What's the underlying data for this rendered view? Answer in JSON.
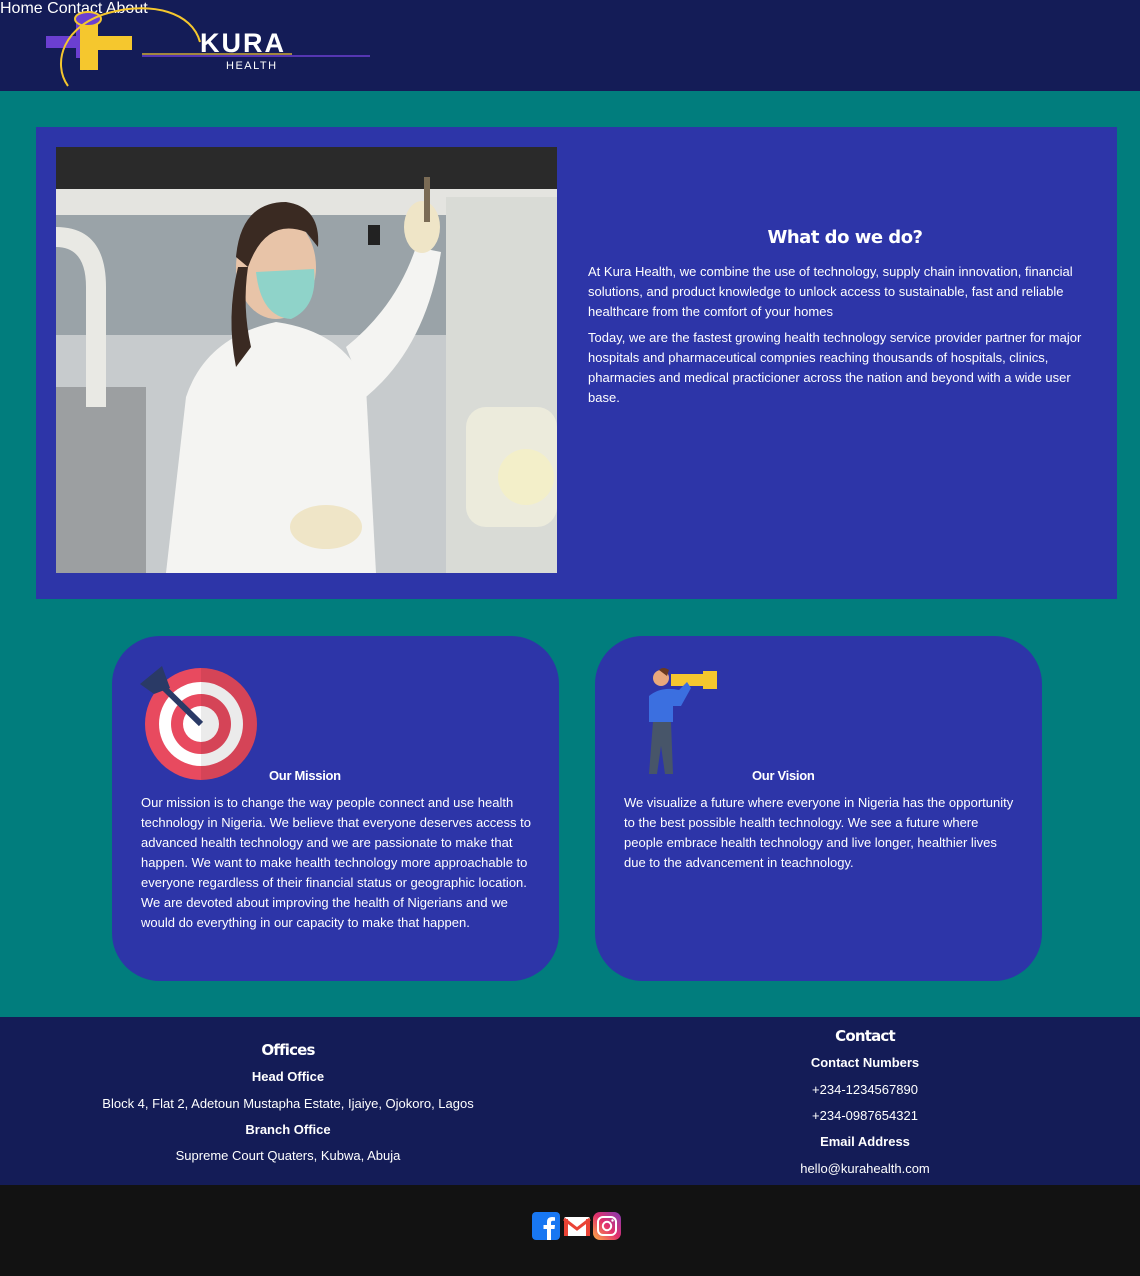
{
  "brand": {
    "name": "KURA",
    "tagline": "HEALTH",
    "colors": {
      "navy": "#141c57",
      "teal": "#017d7d",
      "royal_blue": "#2d35a8",
      "logo_yellow": "#f5c72e",
      "logo_purple": "#6b3fd1"
    }
  },
  "nav": {
    "items": [
      "Home",
      "Contact",
      "About"
    ]
  },
  "hero": {
    "title": "What do we do?",
    "paragraphs": [
      "At Kura Health, we combine the use of technology, supply chain innovation, financial solutions, and product knowledge to unlock access to sustainable, fast and reliable healthcare from the comfort of your homes",
      "Today, we are the fastest growing health technology service provider partner for major hospitals and pharmaceutical compnies reaching thousands of hospitals, clinics, pharmacies and medical practicioner across the nation and beyond with a wide user base."
    ]
  },
  "mission": {
    "title": "Our Mission",
    "icon": "target-dart-icon",
    "body": "Our mission is to change the way people connect and use health technology in Nigeria. We believe that everyone deserves access to advanced health technology and we are passionate to make that happen. We want to make health technology more approachable to everyone regardless of their financial status or geographic location. We are devoted about improving the health of Nigerians and we would do everything in our capacity to make that happen."
  },
  "vision": {
    "title": "Our Vision",
    "icon": "telescope-person-icon",
    "body": "We visualize a future where everyone in Nigeria has the opportunity to the best possible health technology. We see a future where people embrace health technology and live longer, healthier lives due to the advancement in teachnology."
  },
  "footer": {
    "offices": {
      "title": "Offices",
      "head_label": "Head Office",
      "head_address": "Block 4, Flat 2, Adetoun Mustapha Estate, Ijaiye, Ojokoro, Lagos",
      "branch_label": "Branch Office",
      "branch_address": "Supreme Court Quaters, Kubwa, Abuja"
    },
    "contact": {
      "title": "Contact",
      "numbers_label": "Contact Numbers",
      "phone1": "+234-1234567890",
      "phone2": "+234-0987654321",
      "email_label": "Email Address",
      "email": "hello@kurahealth.com"
    }
  },
  "social": [
    "facebook-icon",
    "gmail-icon",
    "instagram-icon"
  ]
}
